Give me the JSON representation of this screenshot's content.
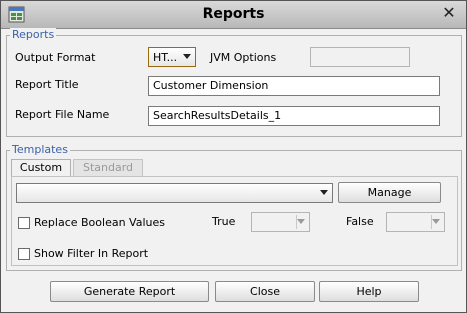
{
  "window": {
    "title": "Reports"
  },
  "reports_group": {
    "legend": "Reports",
    "output_format": {
      "label": "Output Format",
      "value": "HT..."
    },
    "jvm_options": {
      "label": "JVM Options",
      "value": ""
    },
    "report_title": {
      "label": "Report Title",
      "value": "Customer Dimension"
    },
    "report_file_name": {
      "label": "Report File Name",
      "value": "SearchResultsDetails_1"
    }
  },
  "templates_group": {
    "legend": "Templates",
    "tabs": [
      {
        "label": "Custom",
        "active": true
      },
      {
        "label": "Standard",
        "active": false
      }
    ],
    "template_select": {
      "value": ""
    },
    "manage_button": "Manage",
    "replace_boolean": {
      "label": "Replace Boolean Values",
      "checked": false
    },
    "true_label": "True",
    "false_label": "False",
    "show_filter": {
      "label": "Show Filter In Report",
      "checked": false
    }
  },
  "buttons": {
    "generate": "Generate Report",
    "close": "Close",
    "help": "Help"
  },
  "colors": {
    "legend": "#3a62a8",
    "background": "#f1f1f1",
    "titlebar": "#c8c8c8"
  }
}
